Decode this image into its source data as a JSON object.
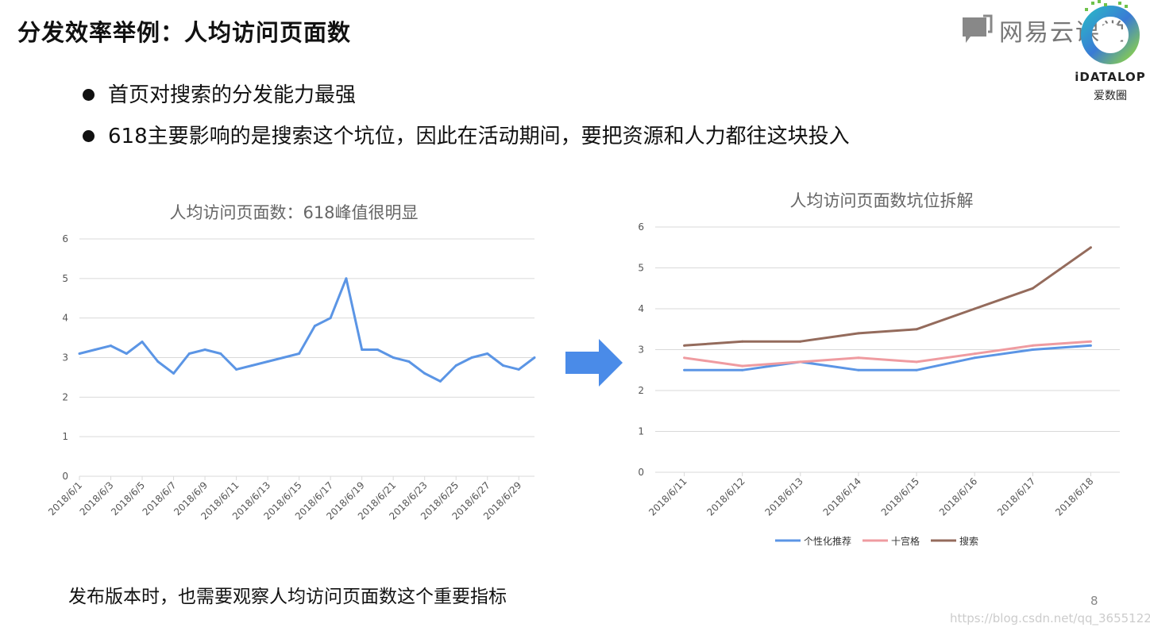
{
  "slide": {
    "title": "分发效率举例：人均访问页面数",
    "brand_name": "网易云课堂",
    "logo_name": "iDATALOP",
    "logo_cn": "爱数圈",
    "bullets": [
      "首页对搜索的分发能力最强",
      "618主要影响的是搜索这个坑位，因此在活动期间，要把资源和人力都往这块投入"
    ],
    "footer": "发布版本时，也需要观察人均访问页面数这个重要指标",
    "page_number": "8",
    "watermark": "https://blog.csdn.net/qq_36551226",
    "colors": {
      "blue": "#5b95e5",
      "pink": "#ef9ba0",
      "brown": "#946b5c",
      "arrow": "#4a8be8"
    }
  },
  "chart_data": [
    {
      "type": "line",
      "title": "人均访问页面数：618峰值很明显",
      "xlabel": "",
      "ylabel": "",
      "ylim": [
        0,
        6
      ],
      "yticks": [
        0,
        1,
        2,
        3,
        4,
        5,
        6
      ],
      "grid": true,
      "x": [
        "2018/6/1",
        "2018/6/2",
        "2018/6/3",
        "2018/6/4",
        "2018/6/5",
        "2018/6/6",
        "2018/6/7",
        "2018/6/8",
        "2018/6/9",
        "2018/6/10",
        "2018/6/11",
        "2018/6/12",
        "2018/6/13",
        "2018/6/14",
        "2018/6/15",
        "2018/6/16",
        "2018/6/17",
        "2018/6/18",
        "2018/6/19",
        "2018/6/20",
        "2018/6/21",
        "2018/6/22",
        "2018/6/23",
        "2018/6/24",
        "2018/6/25",
        "2018/6/26",
        "2018/6/27",
        "2018/6/28",
        "2018/6/29",
        "2018/6/30"
      ],
      "x_tick_labels": [
        "2018/6/1",
        "2018/6/3",
        "2018/6/5",
        "2018/6/7",
        "2018/6/9",
        "2018/6/11",
        "2018/6/13",
        "2018/6/15",
        "2018/6/17",
        "2018/6/19",
        "2018/6/21",
        "2018/6/23",
        "2018/6/25",
        "2018/6/27",
        "2018/6/29"
      ],
      "series": [
        {
          "color": "#5b95e5",
          "values": [
            3.1,
            3.2,
            3.3,
            3.1,
            3.4,
            2.9,
            2.6,
            3.1,
            3.2,
            3.1,
            2.7,
            2.8,
            2.9,
            3.0,
            3.1,
            3.8,
            4.0,
            5.0,
            3.2,
            3.2,
            3.0,
            2.9,
            2.6,
            2.4,
            2.8,
            3.0,
            3.1,
            2.8,
            2.7,
            3.0
          ]
        }
      ]
    },
    {
      "type": "line",
      "title": "人均访问页面数坑位拆解",
      "xlabel": "",
      "ylabel": "",
      "ylim": [
        0,
        6
      ],
      "yticks": [
        0,
        1,
        2,
        3,
        4,
        5,
        6
      ],
      "grid": true,
      "legend": "bottom",
      "x": [
        "2018/6/11",
        "2018/6/12",
        "2018/6/13",
        "2018/6/14",
        "2018/6/15",
        "2018/6/16",
        "2018/6/17",
        "2018/6/18"
      ],
      "series": [
        {
          "name": "个性化推荐",
          "color": "#5b95e5",
          "values": [
            2.5,
            2.5,
            2.7,
            2.5,
            2.5,
            2.8,
            3.0,
            3.1
          ]
        },
        {
          "name": "十宫格",
          "color": "#ef9ba0",
          "values": [
            2.8,
            2.6,
            2.7,
            2.8,
            2.7,
            2.9,
            3.1,
            3.2
          ]
        },
        {
          "name": "搜索",
          "color": "#946b5c",
          "values": [
            3.1,
            3.2,
            3.2,
            3.4,
            3.5,
            4.0,
            4.5,
            5.5
          ]
        }
      ]
    }
  ]
}
